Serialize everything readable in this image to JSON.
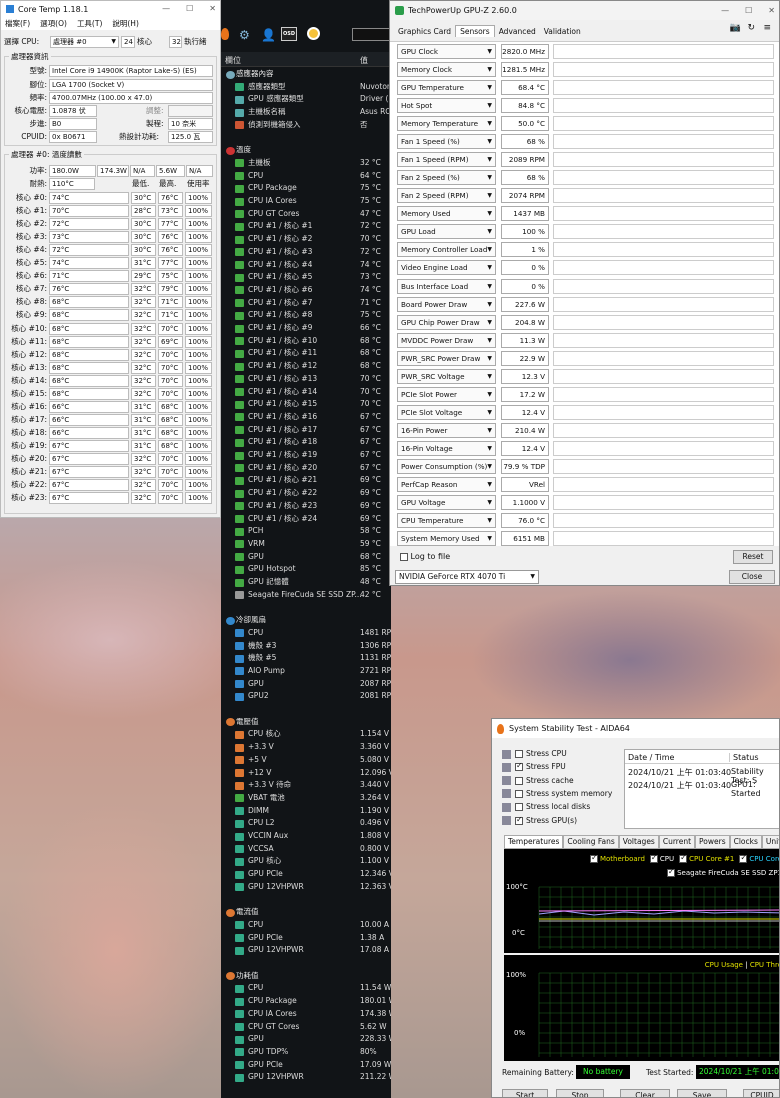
{
  "coretemp": {
    "title": "Core Temp 1.18.1",
    "menu": [
      "檔案(F)",
      "選項(O)",
      "工具(T)",
      "說明(H)"
    ],
    "select_label": "選擇 CPU:",
    "cpu_select": "處理器 #0",
    "cores_n": "24",
    "cores_l": "核心",
    "threads_n": "32",
    "threads_l": "執行緒",
    "info_header": "處理器資訊",
    "model_l": "型號:",
    "model": "Intel Core i9 14900K (Raptor Lake-S)  (ES)",
    "socket_l": "腳位:",
    "socket": "LGA 1700 (Socket V)",
    "freq_l": "頻率:",
    "freq": "4700.07MHz (100.00 x 47.0)",
    "vid_l": "核心電壓:",
    "vid": "1.0878 伏",
    "mod_l": "調整:",
    "step_l": "步進:",
    "step": "B0",
    "proc_l": "製程:",
    "proc": "10 奈米",
    "cpuid_l": "CPUID:",
    "cpuid": "0x B0671",
    "tdp_l": "熱設計功耗:",
    "tdp": "125.0 瓦",
    "temp_header": "處理器 #0: 溫度讀數",
    "power_l": "功率:",
    "power": [
      "180.0W",
      "174.3W",
      "N/A",
      "5.6W",
      "N/A"
    ],
    "tj_l": "耐熱:",
    "tj": "110°C",
    "cols": [
      "最低.",
      "最高.",
      "使用率"
    ],
    "cores": [
      [
        "核心 #0:",
        "74°C",
        "30°C",
        "76°C",
        "100%"
      ],
      [
        "核心 #1:",
        "70°C",
        "28°C",
        "73°C",
        "100%"
      ],
      [
        "核心 #2:",
        "72°C",
        "30°C",
        "77°C",
        "100%"
      ],
      [
        "核心 #3:",
        "73°C",
        "30°C",
        "76°C",
        "100%"
      ],
      [
        "核心 #4:",
        "72°C",
        "30°C",
        "76°C",
        "100%"
      ],
      [
        "核心 #5:",
        "74°C",
        "31°C",
        "77°C",
        "100%"
      ],
      [
        "核心 #6:",
        "71°C",
        "29°C",
        "75°C",
        "100%"
      ],
      [
        "核心 #7:",
        "76°C",
        "32°C",
        "79°C",
        "100%"
      ],
      [
        "核心 #8:",
        "68°C",
        "32°C",
        "71°C",
        "100%"
      ],
      [
        "核心 #9:",
        "68°C",
        "32°C",
        "71°C",
        "100%"
      ],
      [
        "核心 #10:",
        "68°C",
        "32°C",
        "70°C",
        "100%"
      ],
      [
        "核心 #11:",
        "68°C",
        "32°C",
        "69°C",
        "100%"
      ],
      [
        "核心 #12:",
        "68°C",
        "32°C",
        "70°C",
        "100%"
      ],
      [
        "核心 #13:",
        "68°C",
        "32°C",
        "70°C",
        "100%"
      ],
      [
        "核心 #14:",
        "68°C",
        "32°C",
        "70°C",
        "100%"
      ],
      [
        "核心 #15:",
        "68°C",
        "32°C",
        "70°C",
        "100%"
      ],
      [
        "核心 #16:",
        "66°C",
        "31°C",
        "68°C",
        "100%"
      ],
      [
        "核心 #17:",
        "66°C",
        "31°C",
        "68°C",
        "100%"
      ],
      [
        "核心 #18:",
        "66°C",
        "31°C",
        "68°C",
        "100%"
      ],
      [
        "核心 #19:",
        "67°C",
        "31°C",
        "68°C",
        "100%"
      ],
      [
        "核心 #20:",
        "67°C",
        "32°C",
        "70°C",
        "100%"
      ],
      [
        "核心 #21:",
        "67°C",
        "32°C",
        "70°C",
        "100%"
      ],
      [
        "核心 #22:",
        "67°C",
        "32°C",
        "70°C",
        "100%"
      ],
      [
        "核心 #23:",
        "67°C",
        "32°C",
        "70°C",
        "100%"
      ]
    ]
  },
  "hwinfo": {
    "col_name": "欄位",
    "col_value": "值",
    "rows": [
      {
        "t": "sec",
        "n": "感應器內容",
        "c": "#7ab"
      },
      {
        "n": "感應器類型",
        "v": "Nuvoton",
        "c": "#3a7"
      },
      {
        "n": "GPU 感應器類型",
        "v": "Driver (",
        "c": "#5aa"
      },
      {
        "n": "主機板名稱",
        "v": "Asus RO",
        "c": "#5aa"
      },
      {
        "n": "偵測到機箱侵入",
        "v": "否",
        "c": "#c53"
      },
      {
        "t": "gap"
      },
      {
        "t": "sec",
        "n": "溫度",
        "c": "#c33"
      },
      {
        "n": "主機板",
        "v": "32 °C",
        "c": "#4a4"
      },
      {
        "n": "CPU",
        "v": "64 °C",
        "c": "#4a4"
      },
      {
        "n": "CPU Package",
        "v": "75 °C",
        "c": "#4a4"
      },
      {
        "n": "CPU IA Cores",
        "v": "75 °C",
        "c": "#4a4"
      },
      {
        "n": "CPU GT Cores",
        "v": "47 °C",
        "c": "#4a4"
      },
      {
        "n": "CPU #1 / 核心 #1",
        "v": "72 °C",
        "c": "#4a4"
      },
      {
        "n": "CPU #1 / 核心 #2",
        "v": "70 °C",
        "c": "#4a4"
      },
      {
        "n": "CPU #1 / 核心 #3",
        "v": "72 °C",
        "c": "#4a4"
      },
      {
        "n": "CPU #1 / 核心 #4",
        "v": "74 °C",
        "c": "#4a4"
      },
      {
        "n": "CPU #1 / 核心 #5",
        "v": "73 °C",
        "c": "#4a4"
      },
      {
        "n": "CPU #1 / 核心 #6",
        "v": "74 °C",
        "c": "#4a4"
      },
      {
        "n": "CPU #1 / 核心 #7",
        "v": "71 °C",
        "c": "#4a4"
      },
      {
        "n": "CPU #1 / 核心 #8",
        "v": "75 °C",
        "c": "#4a4"
      },
      {
        "n": "CPU #1 / 核心 #9",
        "v": "66 °C",
        "c": "#4a4"
      },
      {
        "n": "CPU #1 / 核心 #10",
        "v": "68 °C",
        "c": "#4a4"
      },
      {
        "n": "CPU #1 / 核心 #11",
        "v": "68 °C",
        "c": "#4a4"
      },
      {
        "n": "CPU #1 / 核心 #12",
        "v": "68 °C",
        "c": "#4a4"
      },
      {
        "n": "CPU #1 / 核心 #13",
        "v": "70 °C",
        "c": "#4a4"
      },
      {
        "n": "CPU #1 / 核心 #14",
        "v": "70 °C",
        "c": "#4a4"
      },
      {
        "n": "CPU #1 / 核心 #15",
        "v": "70 °C",
        "c": "#4a4"
      },
      {
        "n": "CPU #1 / 核心 #16",
        "v": "67 °C",
        "c": "#4a4"
      },
      {
        "n": "CPU #1 / 核心 #17",
        "v": "67 °C",
        "c": "#4a4"
      },
      {
        "n": "CPU #1 / 核心 #18",
        "v": "67 °C",
        "c": "#4a4"
      },
      {
        "n": "CPU #1 / 核心 #19",
        "v": "67 °C",
        "c": "#4a4"
      },
      {
        "n": "CPU #1 / 核心 #20",
        "v": "67 °C",
        "c": "#4a4"
      },
      {
        "n": "CPU #1 / 核心 #21",
        "v": "69 °C",
        "c": "#4a4"
      },
      {
        "n": "CPU #1 / 核心 #22",
        "v": "69 °C",
        "c": "#4a4"
      },
      {
        "n": "CPU #1 / 核心 #23",
        "v": "69 °C",
        "c": "#4a4"
      },
      {
        "n": "CPU #1 / 核心 #24",
        "v": "69 °C",
        "c": "#4a4"
      },
      {
        "n": "PCH",
        "v": "58 °C",
        "c": "#4a4"
      },
      {
        "n": "VRM",
        "v": "59 °C",
        "c": "#4a4"
      },
      {
        "n": "GPU",
        "v": "68 °C",
        "c": "#4a4"
      },
      {
        "n": "GPU Hotspot",
        "v": "85 °C",
        "c": "#4a4"
      },
      {
        "n": "GPU 記憶體",
        "v": "48 °C",
        "c": "#4a4"
      },
      {
        "n": "Seagate FireCuda SE SSD ZP...",
        "v": "42 °C",
        "c": "#999"
      },
      {
        "t": "gap"
      },
      {
        "t": "sec",
        "n": "冷卻風扇",
        "c": "#38c"
      },
      {
        "n": "CPU",
        "v": "1481 RPM",
        "c": "#38c"
      },
      {
        "n": "機殼 #3",
        "v": "1306 RPM",
        "c": "#38c"
      },
      {
        "n": "機殼 #5",
        "v": "1131 RPM",
        "c": "#38c"
      },
      {
        "n": "AIO Pump",
        "v": "2721 RPM",
        "c": "#38c"
      },
      {
        "n": "GPU",
        "v": "2087 RPM  (68%)",
        "c": "#38c"
      },
      {
        "n": "GPU2",
        "v": "2081 RPM  (68%)",
        "c": "#38c"
      },
      {
        "t": "gap"
      },
      {
        "t": "sec",
        "n": "電壓值",
        "c": "#d73"
      },
      {
        "n": "CPU 核心",
        "v": "1.154 V",
        "c": "#d73"
      },
      {
        "n": "+3.3 V",
        "v": "3.360 V",
        "c": "#d73"
      },
      {
        "n": "+5 V",
        "v": "5.080 V",
        "c": "#d73"
      },
      {
        "n": "+12 V",
        "v": "12.096 V",
        "c": "#d73"
      },
      {
        "n": "+3.3 V 待命",
        "v": "3.440 V",
        "c": "#d73"
      },
      {
        "n": "VBAT 電池",
        "v": "3.264 V",
        "c": "#4a4"
      },
      {
        "n": "DIMM",
        "v": "1.190 V",
        "c": "#3a8"
      },
      {
        "n": "CPU L2",
        "v": "0.496 V",
        "c": "#3a8"
      },
      {
        "n": "VCCIN Aux",
        "v": "1.808 V",
        "c": "#3a8"
      },
      {
        "n": "VCCSA",
        "v": "0.800 V",
        "c": "#3a8"
      },
      {
        "n": "GPU 核心",
        "v": "1.100 V",
        "c": "#3a8"
      },
      {
        "n": "GPU PCIe",
        "v": "12.346 V",
        "c": "#3a8"
      },
      {
        "n": "GPU 12VHPWR",
        "v": "12.363 V",
        "c": "#3a8"
      },
      {
        "t": "gap"
      },
      {
        "t": "sec",
        "n": "電流值",
        "c": "#d73"
      },
      {
        "n": "CPU",
        "v": "10.00 A",
        "c": "#3a8"
      },
      {
        "n": "GPU PCIe",
        "v": "1.38 A",
        "c": "#3a8"
      },
      {
        "n": "GPU 12VHPWR",
        "v": "17.08 A",
        "c": "#3a8"
      },
      {
        "t": "gap"
      },
      {
        "t": "sec",
        "n": "功耗值",
        "c": "#d73"
      },
      {
        "n": "CPU",
        "v": "11.54 W",
        "c": "#3a8"
      },
      {
        "n": "CPU Package",
        "v": "180.01 W",
        "c": "#3a8"
      },
      {
        "n": "CPU IA Cores",
        "v": "174.38 W",
        "c": "#3a8"
      },
      {
        "n": "CPU GT Cores",
        "v": "5.62 W",
        "c": "#3a8"
      },
      {
        "n": "GPU",
        "v": "228.33 W",
        "c": "#3a8"
      },
      {
        "n": "GPU TDP%",
        "v": "80%",
        "c": "#3a8"
      },
      {
        "n": "GPU PCIe",
        "v": "17.09 W",
        "c": "#3a8"
      },
      {
        "n": "GPU 12VHPWR",
        "v": "211.22 W",
        "c": "#3a8"
      }
    ]
  },
  "gpuz": {
    "title": "TechPowerUp GPU-Z 2.60.0",
    "tabs": [
      "Graphics Card",
      "Sensors",
      "Advanced",
      "Validation"
    ],
    "rows": [
      {
        "n": "GPU Clock",
        "v": "2820.0 MHz",
        "f": 1.0
      },
      {
        "n": "Memory Clock",
        "v": "1281.5 MHz",
        "f": 1.0
      },
      {
        "n": "GPU Temperature",
        "v": "68.4 °C",
        "f": 0.9
      },
      {
        "n": "Hot Spot",
        "v": "84.8 °C",
        "f": 0.95
      },
      {
        "n": "Memory Temperature",
        "v": "50.0 °C",
        "f": 0.7
      },
      {
        "n": "Fan 1 Speed (%)",
        "v": "68 %",
        "f": 0.75
      },
      {
        "n": "Fan 1 Speed (RPM)",
        "v": "2089 RPM",
        "f": 0.75
      },
      {
        "n": "Fan 2 Speed (%)",
        "v": "68 %",
        "f": 0.75
      },
      {
        "n": "Fan 2 Speed (RPM)",
        "v": "2074 RPM",
        "f": 0.75
      },
      {
        "n": "Memory Used",
        "v": "1437 MB",
        "f": 0.45
      },
      {
        "n": "GPU Load",
        "v": "100 %",
        "f": 1.0
      },
      {
        "n": "Memory Controller Load",
        "v": "1 %",
        "f": 0.0
      },
      {
        "n": "Video Engine Load",
        "v": "0 %",
        "f": 0.0
      },
      {
        "n": "Bus Interface Load",
        "v": "0 %",
        "f": 0.0
      },
      {
        "n": "Board Power Draw",
        "v": "227.6 W",
        "f": 0.7
      },
      {
        "n": "GPU Chip Power Draw",
        "v": "204.8 W",
        "f": 0.7
      },
      {
        "n": "MVDDC Power Draw",
        "v": "11.3 W",
        "f": 0.6
      },
      {
        "n": "PWR_SRC Power Draw",
        "v": "22.9 W",
        "f": 0.75
      },
      {
        "n": "PWR_SRC Voltage",
        "v": "12.3 V",
        "f": 0.85
      },
      {
        "n": "PCIe Slot Power",
        "v": "17.2 W",
        "f": 0.65
      },
      {
        "n": "PCIe Slot Voltage",
        "v": "12.4 V",
        "f": 0.85
      },
      {
        "n": "16-Pin Power",
        "v": "210.4 W",
        "f": 0.7
      },
      {
        "n": "16-Pin Voltage",
        "v": "12.4 V",
        "f": 0.85
      },
      {
        "n": "Power Consumption (%)",
        "v": "79.9 % TDP",
        "f": 0.7
      },
      {
        "n": "PerfCap Reason",
        "v": "VRel",
        "f": 1.0,
        "blue": true
      },
      {
        "n": "GPU Voltage",
        "v": "1.1000 V",
        "f": 0.8
      },
      {
        "n": "CPU Temperature",
        "v": "76.0 °C",
        "f": 0.85
      },
      {
        "n": "System Memory Used",
        "v": "6151 MB",
        "f": 0.85
      }
    ],
    "log": "Log to file",
    "reset": "Reset",
    "card": "NVIDIA GeForce RTX 4070 Ti",
    "close": "Close"
  },
  "aida": {
    "title": "System Stability Test - AIDA64",
    "stress": [
      {
        "l": "Stress CPU",
        "on": false
      },
      {
        "l": "Stress FPU",
        "on": true
      },
      {
        "l": "Stress cache",
        "on": false
      },
      {
        "l": "Stress system memory",
        "on": false
      },
      {
        "l": "Stress local disks",
        "on": false
      },
      {
        "l": "Stress GPU(s)",
        "on": true
      }
    ],
    "log_cols": [
      "Date / Time",
      "Status"
    ],
    "log": [
      [
        "2024/10/21 上午 01:03:40",
        "Stability Test: S"
      ],
      [
        "2024/10/21 上午 01:03:40",
        "GPU1: Started"
      ]
    ],
    "tabs": [
      "Temperatures",
      "Cooling Fans",
      "Voltages",
      "Current",
      "Powers",
      "Clocks",
      "Unifie"
    ],
    "legend": [
      "Motherboard",
      "CPU",
      "CPU Core #1",
      "CPU Core"
    ],
    "legend2": "Seagate FireCuda SE SSD ZP1",
    "y_top": "100°C",
    "y_bot": "0°C",
    "u_top": "100%",
    "u_bot": "0%",
    "usage_label": "CPU Usage",
    "throttle_label": "CPU Thro",
    "batt_l": "Remaining Battery:",
    "batt": "No battery",
    "start_l": "Test Started:",
    "start": "2024/10/21 上午 01:03:4",
    "buttons": [
      "Start",
      "Stop",
      "Clear",
      "Save",
      "CPUID"
    ]
  }
}
